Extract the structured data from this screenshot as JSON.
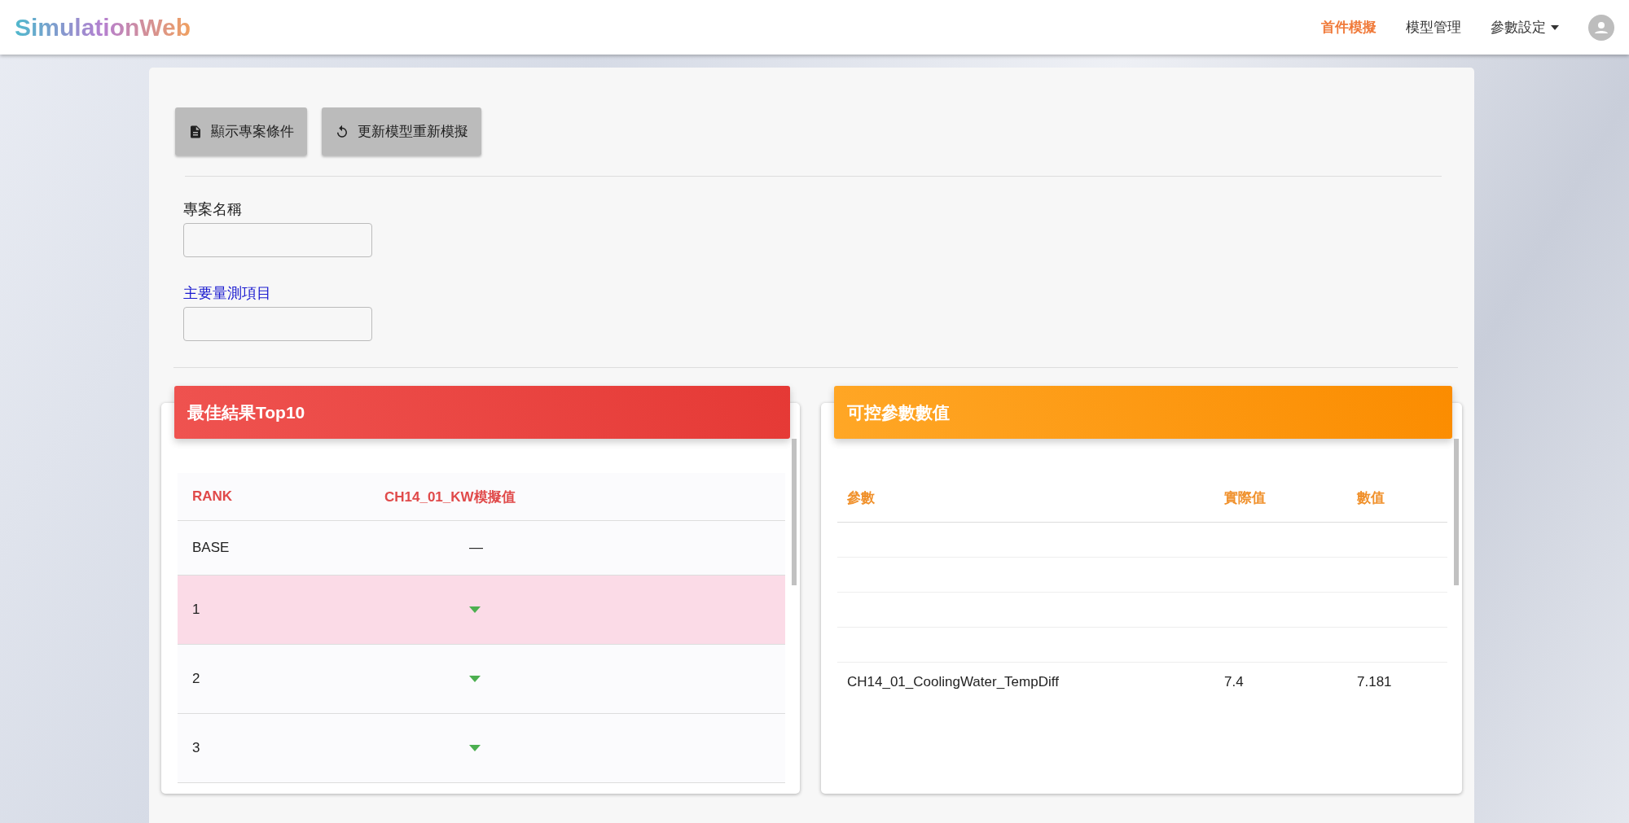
{
  "brand": "SimulationWeb",
  "nav": [
    {
      "label": "首件模擬",
      "selected": true,
      "dropdown": false
    },
    {
      "label": "模型管理",
      "selected": false,
      "dropdown": false
    },
    {
      "label": "參數設定",
      "selected": false,
      "dropdown": true
    }
  ],
  "toolbar": [
    {
      "label": "顯示專案條件",
      "kind": "document"
    },
    {
      "label": "更新模型重新模擬",
      "kind": "refresh"
    }
  ],
  "fields": [
    {
      "label": "專案名稱",
      "highlight": false
    },
    {
      "label": "主要量測項目",
      "highlight": true
    }
  ],
  "top_results": {
    "title": "最佳結果Top10",
    "columns": [
      "RANK",
      "CH14_01_KW模擬值"
    ],
    "rows": [
      {
        "rank": "BASE",
        "kind": "base",
        "value": "—",
        "selected": false
      },
      {
        "rank": "1",
        "kind": "down",
        "selected": true
      },
      {
        "rank": "2",
        "kind": "down",
        "selected": false
      },
      {
        "rank": "3",
        "kind": "down",
        "selected": false
      }
    ]
  },
  "parameters": {
    "title": "可控參數數值",
    "columns": [
      "參數",
      "實際值",
      "數值"
    ],
    "rows": [
      {
        "parameter": "CH14_01_CoolingWater_TempDiff",
        "actual": "7.4",
        "value": "7.181"
      }
    ]
  }
}
